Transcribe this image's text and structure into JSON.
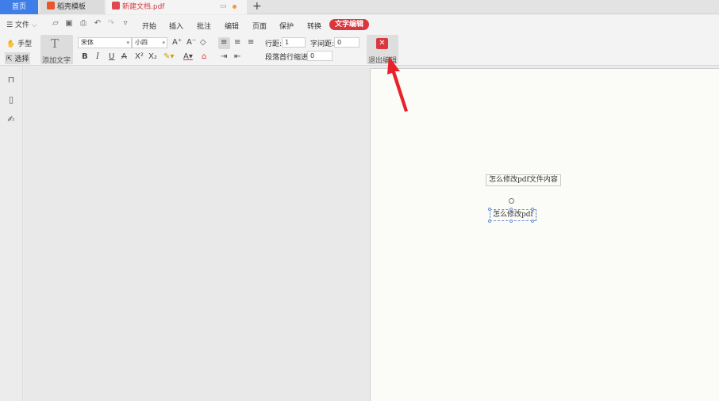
{
  "tabs": {
    "home": "首页",
    "templates": "稻壳模板",
    "document": "新建文档.pdf"
  },
  "menu": {
    "file": "文件",
    "items": [
      "开始",
      "插入",
      "批注",
      "编辑",
      "页面",
      "保护",
      "转换"
    ],
    "active": "文字编辑"
  },
  "ribbon": {
    "hand_tool": "手型",
    "select_tool": "选择",
    "add_text": "添加文字",
    "font_name": "宋体",
    "font_size": "小四",
    "line_spacing_label": "行距:",
    "line_spacing_value": "1",
    "char_spacing_label": "字间距:",
    "char_spacing_value": "0",
    "indent_label": "段落首行缩进:",
    "indent_value": "0",
    "exit_edit": "退出编辑"
  },
  "document": {
    "text_box_1": "怎么修改pdf文件内容",
    "text_box_2": "怎么修改pdf"
  },
  "colors": {
    "accent": "#d9363e",
    "home_tab": "#3f7ee8"
  }
}
